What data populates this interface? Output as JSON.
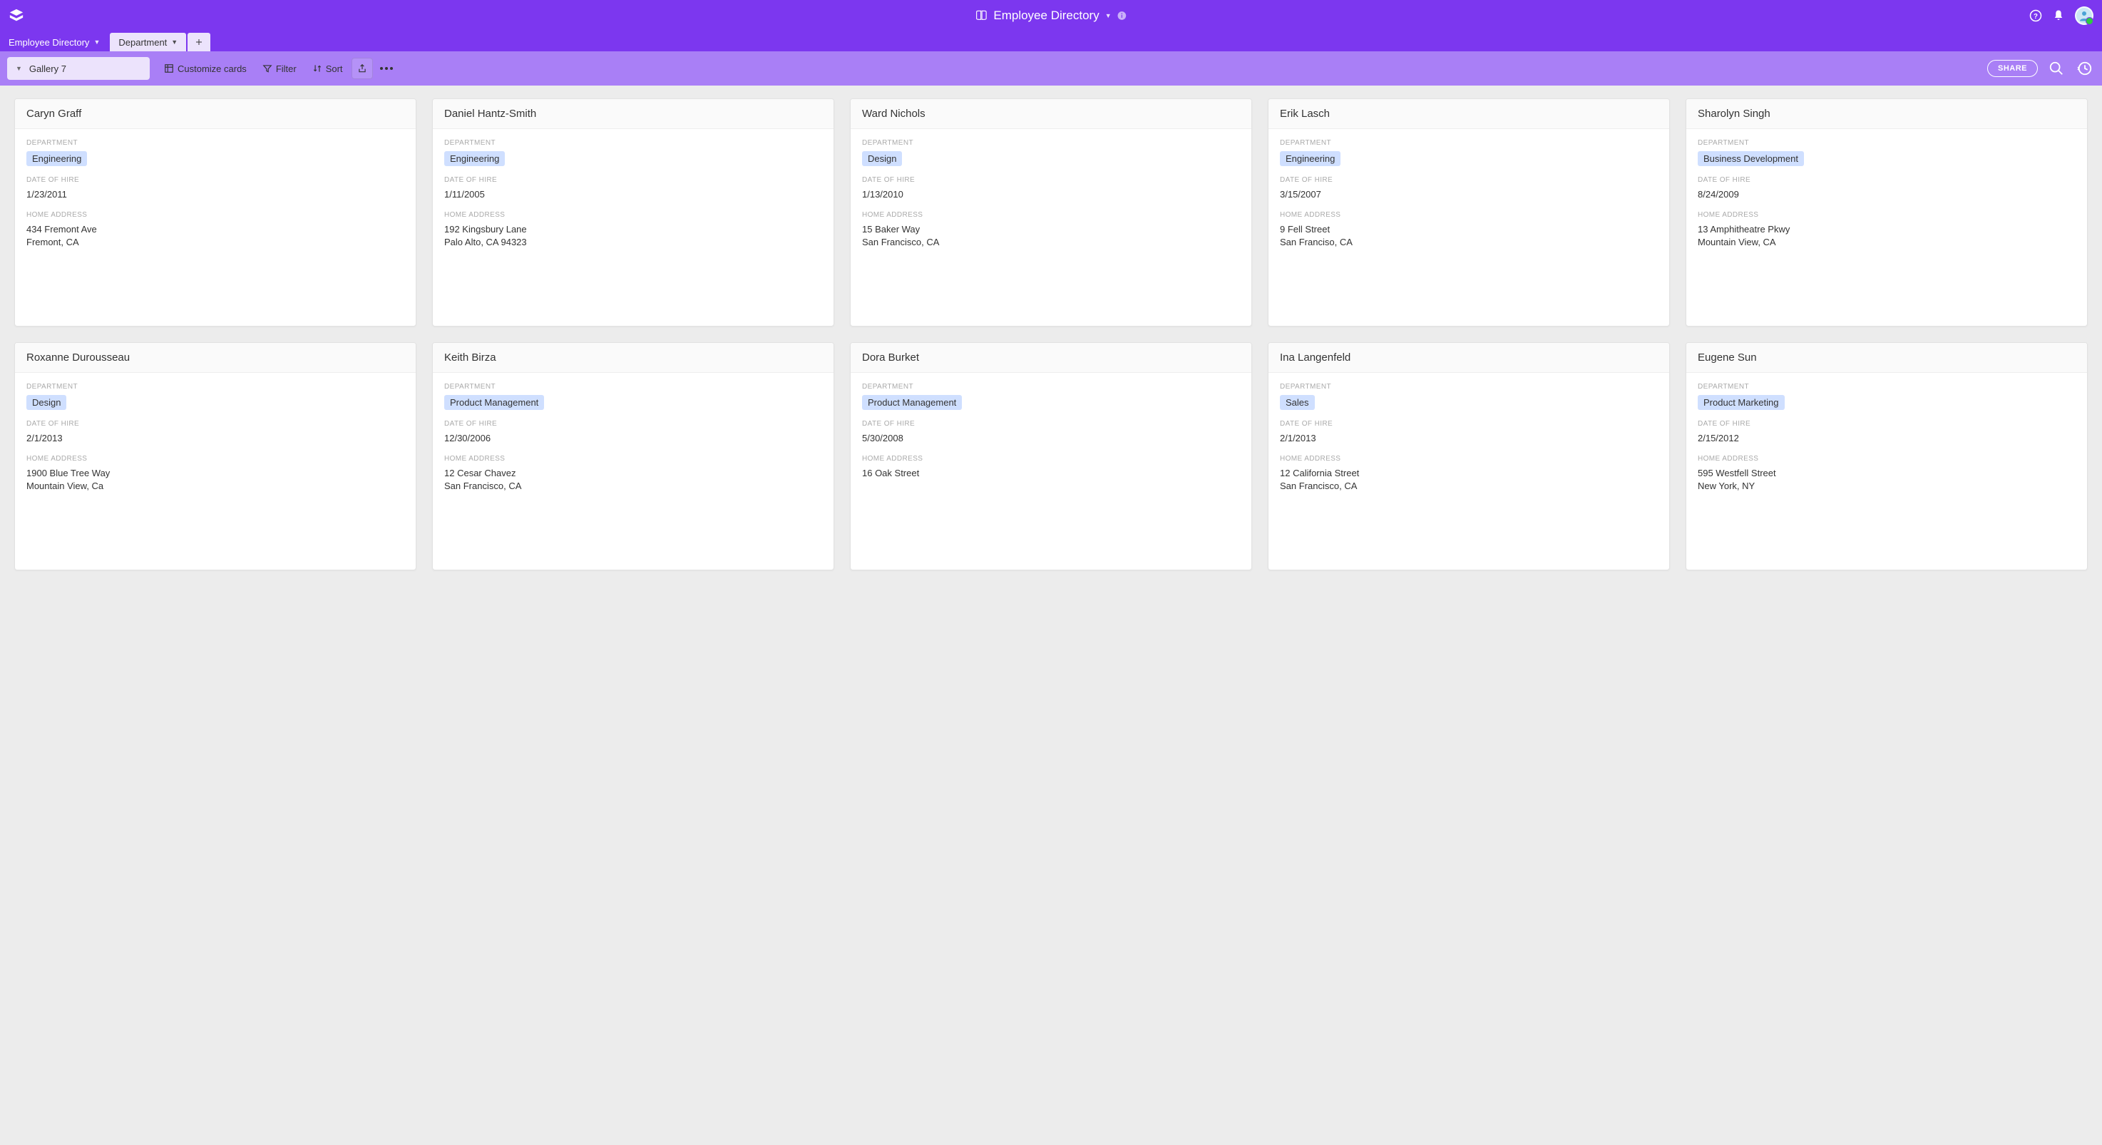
{
  "header": {
    "base_name": "Employee Directory"
  },
  "tabs": [
    {
      "label": "Employee Directory",
      "active": false
    },
    {
      "label": "Department",
      "active": true
    }
  ],
  "viewbar": {
    "view_name": "Gallery 7",
    "customize": "Customize cards",
    "filter": "Filter",
    "sort": "Sort",
    "share": "SHARE"
  },
  "fields": {
    "department": "DEPARTMENT",
    "date_of_hire": "DATE OF HIRE",
    "home_address": "HOME ADDRESS"
  },
  "cards": [
    {
      "name": "Caryn Graff",
      "department": "Engineering",
      "hire": "1/23/2011",
      "address": "434 Fremont Ave\nFremont, CA"
    },
    {
      "name": "Daniel Hantz-Smith",
      "department": "Engineering",
      "hire": "1/11/2005",
      "address": "192 Kingsbury Lane\nPalo Alto, CA 94323"
    },
    {
      "name": "Ward Nichols",
      "department": "Design",
      "hire": "1/13/2010",
      "address": "15 Baker Way\nSan Francisco, CA"
    },
    {
      "name": "Erik Lasch",
      "department": "Engineering",
      "hire": "3/15/2007",
      "address": "9 Fell Street\nSan Franciso, CA"
    },
    {
      "name": "Sharolyn Singh",
      "department": "Business Development",
      "hire": "8/24/2009",
      "address": "13 Amphitheatre Pkwy\nMountain View, CA"
    },
    {
      "name": "Roxanne Durousseau",
      "department": "Design",
      "hire": "2/1/2013",
      "address": "1900 Blue Tree Way\nMountain View, Ca"
    },
    {
      "name": "Keith Birza",
      "department": "Product Management",
      "hire": "12/30/2006",
      "address": "12 Cesar Chavez\nSan Francisco, CA"
    },
    {
      "name": "Dora Burket",
      "department": "Product Management",
      "hire": "5/30/2008",
      "address": "16 Oak Street"
    },
    {
      "name": "Ina Langenfeld",
      "department": "Sales",
      "hire": "2/1/2013",
      "address": "12 California Street\nSan Francisco, CA"
    },
    {
      "name": "Eugene Sun",
      "department": "Product Marketing",
      "hire": "2/15/2012",
      "address": "595 Westfell Street\nNew York, NY"
    }
  ]
}
